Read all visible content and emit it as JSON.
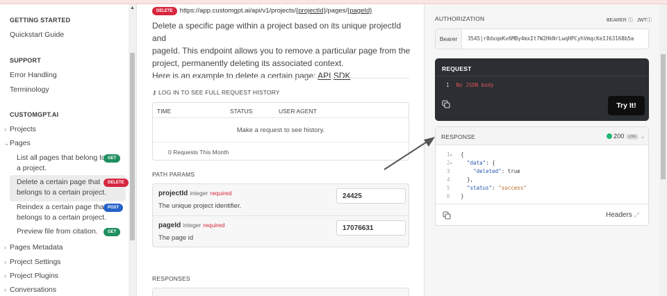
{
  "sidebar": {
    "getting_started": "GETTING STARTED",
    "quickstart": "Quickstart Guide",
    "support": "SUPPORT",
    "error_handling": "Error Handling",
    "terminology": "Terminology",
    "customgpt": "CUSTOMGPT.AI",
    "projects": "Projects",
    "pages": "Pages",
    "sub_items": [
      {
        "line1": "List all pages that belong to",
        "line2": "a project.",
        "method": "GET"
      },
      {
        "line1": "Delete a certain page that",
        "line2": "belongs to a certain project.",
        "method": "DELETE"
      },
      {
        "line1": "Reindex a certain page that",
        "line2": "belongs to a certain project.",
        "method": "POST"
      },
      {
        "line1": "Preview file from citation.",
        "line2": "",
        "method": "GET"
      }
    ],
    "pages_metadata": "Pages Metadata",
    "project_settings": "Project Settings",
    "project_plugins": "Project Plugins",
    "conversations": "Conversations"
  },
  "main": {
    "method": "DELETE",
    "url_prefix": "https://app.customgpt.ai/api/v1/projects/",
    "url_p1": "{projectId}",
    "url_mid": "/pages/",
    "url_p2": "{pageId}",
    "description_lines": [
      "Delete a specific page within a project based on its unique projectId and",
      "pageId. This endpoint allows you to remove a particular page from the",
      "project, permanently deleting its associated context."
    ],
    "example_text": "Here is an example to delete a certain page: ",
    "api_link": "API",
    "sdk_link": "SDK",
    "login_history": "LOG IN TO SEE FULL REQUEST HISTORY",
    "history_cols": [
      "TIME",
      "STATUS",
      "USER AGENT"
    ],
    "history_empty": "Make a request to see history.",
    "history_count": "0 Requests This Month",
    "path_params_title": "PATH PARAMS",
    "params": [
      {
        "name": "projectId",
        "type": "integer",
        "required": "required",
        "desc": "The unique project identifier.",
        "value": "24425"
      },
      {
        "name": "pageId",
        "type": "integer",
        "required": "required",
        "desc": "The page id",
        "value": "17076631"
      }
    ],
    "responses_title": "RESPONSES"
  },
  "right": {
    "auth_title": "AUTHORIZATION",
    "bearer_label": "BEARER",
    "jwt_label": "JWT",
    "auth_field_label": "Bearer",
    "auth_value": "3545|r8dxqeKv6MBy4mxIt7W2HkNrLwqHPCyhVmqcKeIJ63168b5a",
    "request_title": "REQUEST",
    "request_line_no": "1",
    "request_body": "No JSON body",
    "try_it": "Try It!",
    "response_title": "RESPONSE",
    "response_status": "200",
    "response_log": "LOG",
    "headers_label": "Headers"
  }
}
